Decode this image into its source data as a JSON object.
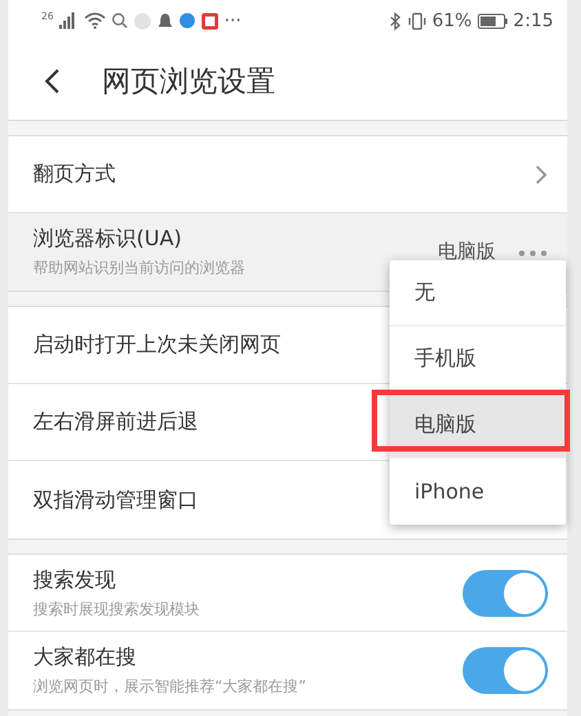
{
  "status_bar": {
    "network": "26",
    "more": "···",
    "battery": "61%",
    "time": "2:15"
  },
  "header": {
    "title": "网页浏览设置"
  },
  "sections": [
    [
      {
        "kind": "link",
        "label": "翻页方式",
        "pressed": false
      },
      {
        "kind": "value",
        "label": "浏览器标识(UA)",
        "description": "帮助网站识别当前访问的浏览器",
        "value": "电脑版",
        "pressed": true
      }
    ],
    [
      {
        "kind": "plain",
        "label": "启动时打开上次未关闭网页"
      },
      {
        "kind": "plain",
        "label": "左右滑屏前进后退"
      },
      {
        "kind": "plain",
        "label": "双指滑动管理窗口"
      }
    ],
    [
      {
        "kind": "toggle",
        "label": "搜索发现",
        "description": "搜索时展现搜索发现模块",
        "on": true
      },
      {
        "kind": "toggle",
        "label": "大家都在搜",
        "description": "浏览网页时，展示智能推荐“大家都在搜”",
        "on": true
      }
    ]
  ],
  "menu": {
    "items": [
      {
        "label": "无",
        "selected": false,
        "marked": false
      },
      {
        "label": "手机版",
        "selected": false,
        "marked": false
      },
      {
        "label": "电脑版",
        "selected": true,
        "marked": true
      },
      {
        "label": "iPhone",
        "selected": false,
        "marked": false
      }
    ]
  }
}
